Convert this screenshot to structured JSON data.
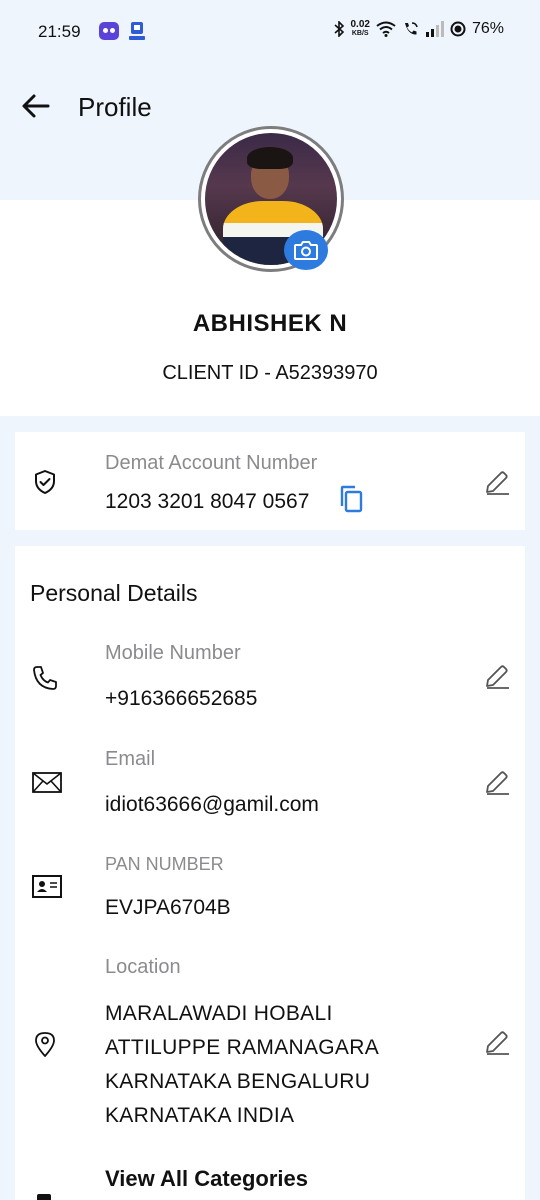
{
  "status_bar": {
    "time": "21:59",
    "net_speed_value": "0.02",
    "net_speed_unit": "KB/S",
    "battery": "76%"
  },
  "header": {
    "title": "Profile",
    "back_icon": "arrow-left-icon"
  },
  "profile": {
    "name": "ABHISHEK N",
    "client_id": "CLIENT ID - A52393970",
    "camera_icon": "camera-icon"
  },
  "demat": {
    "label": "Demat Account Number",
    "value": "1203 3201 8047 0567",
    "icon": "shield-check-icon"
  },
  "personal": {
    "title": "Personal Details",
    "mobile": {
      "label": "Mobile Number",
      "value": "+916366652685"
    },
    "email": {
      "label": "Email",
      "value": "idiot63666@gamil.com"
    },
    "pan": {
      "label": "PAN NUMBER",
      "value": "EVJPA6704B"
    },
    "location": {
      "label": "Location",
      "lines": [
        "MARALAWADI HOBALI",
        "ATTILUPPE RAMANAGARA",
        "KARNATAKA BENGALURU",
        "KARNATAKA INDIA"
      ]
    },
    "view_all": "View All Categories"
  },
  "colors": {
    "accent": "#2e7be0",
    "background": "#eef5fd",
    "muted_text": "#8b8b8f"
  }
}
